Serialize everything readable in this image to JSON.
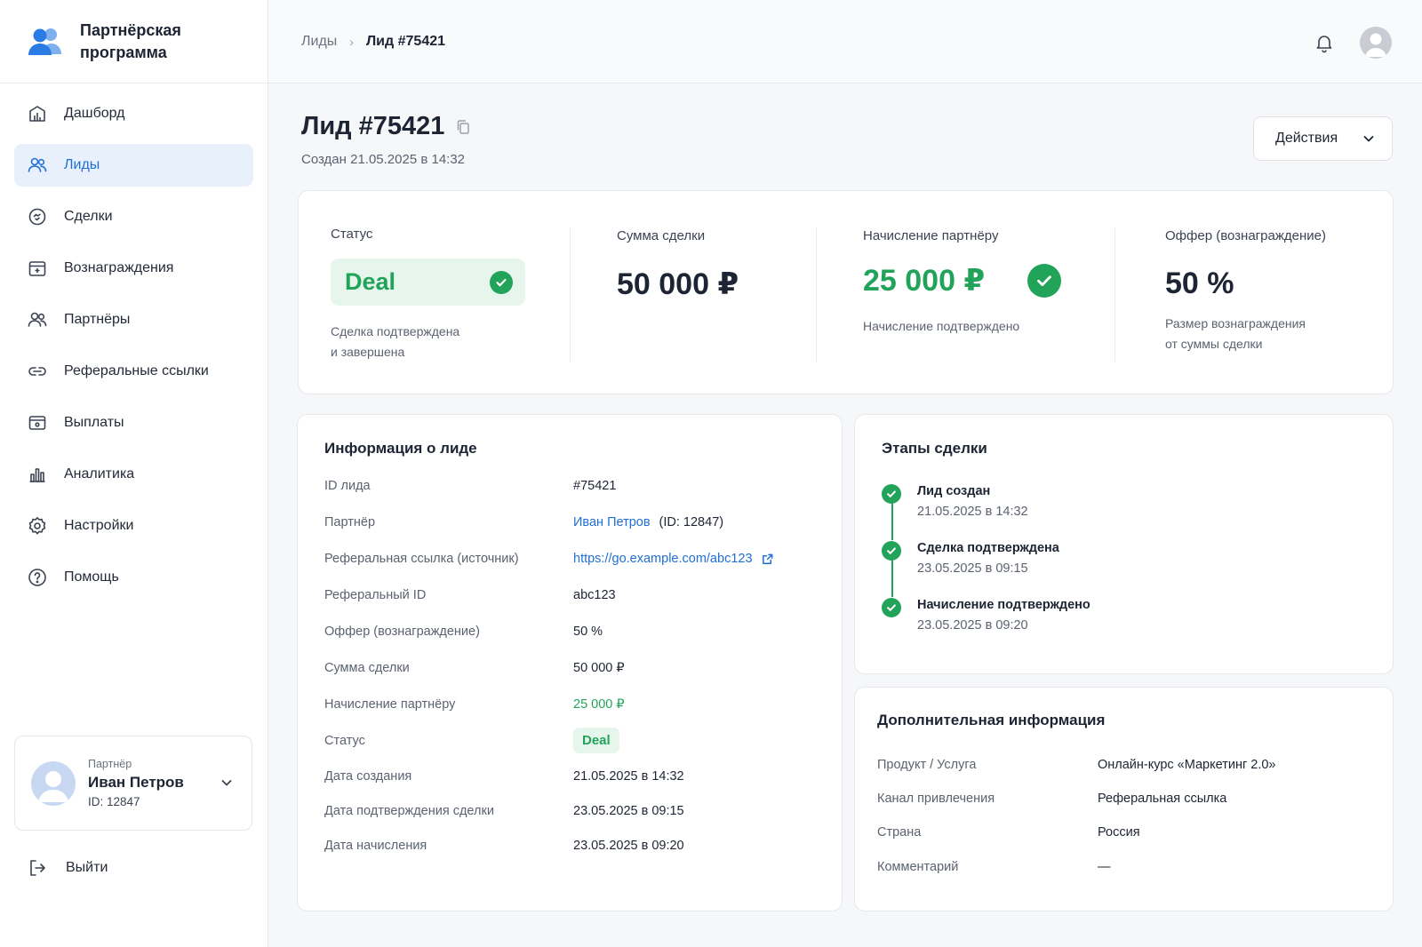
{
  "brand": {
    "title_line1": "Партнёрская",
    "title_line2": "программа"
  },
  "sidebar": {
    "items": [
      {
        "label": "Дашборд",
        "icon": "dashboard-icon"
      },
      {
        "label": "Лиды",
        "icon": "users-icon",
        "active": true
      },
      {
        "label": "Сделки",
        "icon": "handshake-icon"
      },
      {
        "label": "Вознаграждения",
        "icon": "reward-icon"
      },
      {
        "label": "Партнёры",
        "icon": "partners-icon"
      },
      {
        "label": "Реферальные ссылки",
        "icon": "link-icon"
      },
      {
        "label": "Выплаты",
        "icon": "wallet-icon"
      },
      {
        "label": "Аналитика",
        "icon": "chart-icon"
      },
      {
        "label": "Настройки",
        "icon": "gear-icon"
      },
      {
        "label": "Помощь",
        "icon": "help-icon"
      }
    ],
    "user": {
      "role": "Партнёр",
      "name": "Иван Петров",
      "id": "ID: 12847"
    },
    "logout_label": "Выйти"
  },
  "header": {
    "breadcrumb": {
      "parent": "Лиды",
      "separator": "›",
      "current": "Лид #75421"
    }
  },
  "page": {
    "title": "Лид #75421",
    "created": "Создан 21.05.2025 в 14:32",
    "actions_label": "Действия"
  },
  "summary": {
    "status": {
      "label": "Статус",
      "value": "Deal",
      "note_line1": "Сделка подтверждена",
      "note_line2": "и завершена"
    },
    "amount": {
      "label": "Сумма сделки",
      "value": "50 000 ₽"
    },
    "accrual": {
      "label": "Начисление партнёру",
      "value": "25 000 ₽",
      "note": "Начисление подтверждено"
    },
    "offer": {
      "label": "Оффер (вознаграждение)",
      "value": "50 %",
      "note_line1": "Размер вознаграждения",
      "note_line2": "от суммы сделки"
    }
  },
  "lead_info": {
    "title": "Информация о лиде",
    "rows": [
      {
        "key": "ID лида",
        "value": "#75421"
      },
      {
        "key": "Партнёр",
        "value": "Иван Петров",
        "extra": "(ID: 12847)"
      },
      {
        "key": "Реферальная ссылка (источник)",
        "value": "https://go.example.com/abc123"
      },
      {
        "key": "Реферальный ID",
        "value": "abc123"
      },
      {
        "key": "Оффер (вознаграждение)",
        "value": "50 %"
      },
      {
        "key": "Сумма сделки",
        "value": "50 000 ₽"
      },
      {
        "key": "Начисление партнёру",
        "value": "25 000 ₽"
      },
      {
        "key": "Статус",
        "value": "Deal"
      },
      {
        "key": "Дата создания",
        "value": "21.05.2025 в 14:32"
      },
      {
        "key": "Дата подтверждения сделки",
        "value": "23.05.2025 в 09:15"
      },
      {
        "key": "Дата начисления",
        "value": "23.05.2025 в 09:20"
      }
    ]
  },
  "stages": {
    "title": "Этапы сделки",
    "items": [
      {
        "title": "Лид создан",
        "date": "21.05.2025 в 14:32"
      },
      {
        "title": "Сделка подтверждена",
        "date": "23.05.2025 в 09:15"
      },
      {
        "title": "Начисление подтверждено",
        "date": "23.05.2025 в 09:20"
      }
    ]
  },
  "extra": {
    "title": "Дополнительная информация",
    "rows": [
      {
        "key": "Продукт / Услуга",
        "value": "Онлайн-курс «Маркетинг 2.0»"
      },
      {
        "key": "Канал привлечения",
        "value": "Реферальная ссылка"
      },
      {
        "key": "Страна",
        "value": "Россия"
      },
      {
        "key": "Комментарий",
        "value": "—"
      }
    ]
  },
  "colors": {
    "accent": "#1f6fd6",
    "success": "#22a35a",
    "active_bg": "#e8f0fc"
  }
}
